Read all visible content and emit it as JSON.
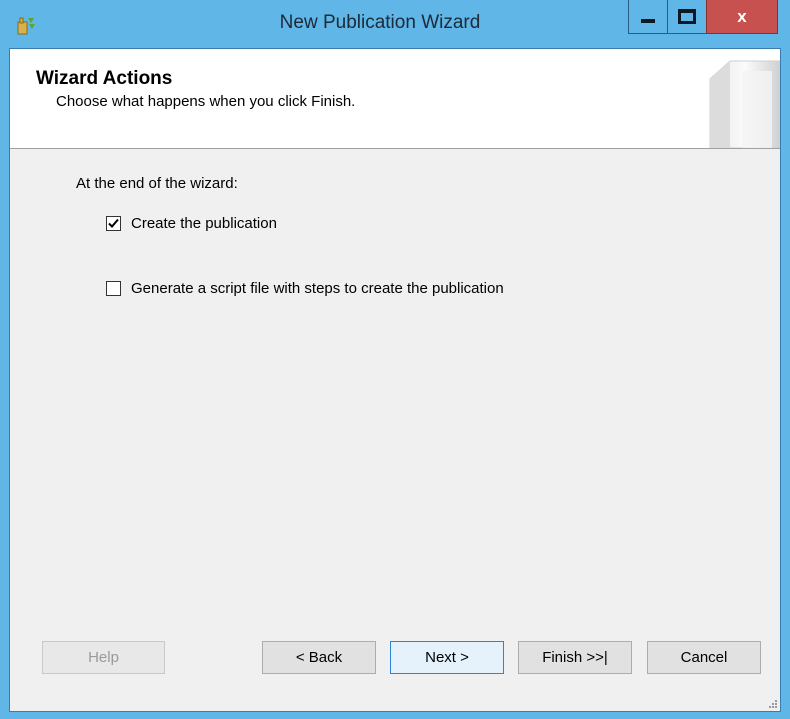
{
  "window": {
    "title": "New Publication Wizard",
    "close_label": "x"
  },
  "header": {
    "title": "Wizard Actions",
    "subtitle": "Choose what happens when you click Finish."
  },
  "body": {
    "label": "At the end of the wizard:",
    "options": [
      {
        "label": "Create the publication",
        "checked": true
      },
      {
        "label": "Generate a script file with steps to create the publication",
        "checked": false
      }
    ]
  },
  "buttons": {
    "help": "Help",
    "back": "< Back",
    "next": "Next >",
    "finish": "Finish >>|",
    "cancel": "Cancel"
  },
  "colors": {
    "titlebar": "#5fb6e7",
    "close_button": "#c7514e",
    "dialog_bg": "#f0f0f0"
  }
}
